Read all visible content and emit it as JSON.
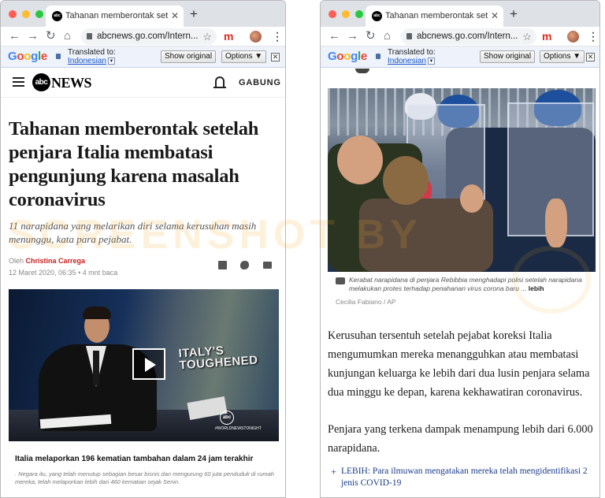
{
  "windows": [
    {
      "tab_title": "Tahanan memberontak setelah p",
      "tab_favicon": "abc",
      "address": "abcnews.go.com/Intern...",
      "translate": {
        "translated_to": "Translated to:",
        "language": "Indonesian",
        "show_original": "Show original",
        "options": "Options ▼"
      }
    },
    {
      "tab_title": "Tahanan memberontak setelah p",
      "tab_favicon": "abc",
      "address": "abcnews.go.com/Intern...",
      "translate": {
        "translated_to": "Translated to:",
        "language": "Indonesian",
        "show_original": "Show original",
        "options": "Options ▼"
      }
    }
  ],
  "icons": {
    "back": "←",
    "forward": "→",
    "reload": "↻",
    "home": "⌂",
    "star": "☆",
    "close": "✕",
    "new_tab": "+",
    "menu": "⋮",
    "extension": "m",
    "translate_close": "✕",
    "play": "play-icon"
  },
  "site": {
    "logo": "abc",
    "logo_text": "NEWS",
    "join": "GABUNG"
  },
  "article": {
    "headline": "Tahanan memberontak setelah penjara Italia membatasi pengunjung karena masalah coronavirus",
    "subhead": "11 narapidana yang melarikan diri selama kerusuhan masih menunggu, kata para pejabat.",
    "by_prefix": "Oleh",
    "author": "Christina Carrega",
    "date": "12 Maret 2020, 06:35",
    "read_time": "• 4 mnt baca",
    "video": {
      "overlay_text": "ITALY'S TOUGHENED",
      "badge": "abc",
      "hashtag": "#WORLDNEWSTONIGHT",
      "title": "Italia melaporkan 196 kematian tambahan dalam 24 jam terakhir",
      "description": ". Negara itu, yang telah menutup sebagian besar bisnis dan mengurung 60 juta penduduk di rumah mereka, telah melaporkan lebih dari 460 kematian sejak Senin."
    },
    "photo": {
      "caption": "Kerabat narapidana di penjara Rebibbia menghadapi polisi setelah narapidana melakukan protes terhadap penahanan virus corona baru ...",
      "caption_more": "lebih",
      "credit": "Cecilia Fabiano / AP"
    },
    "paragraph1": "Kerusuhan tersentuh setelah pejabat koreksi Italia mengumumkan mereka menangguhkan atau membatasi kunjungan keluarga ke lebih dari dua lusin penjara selama dua minggu ke depan, karena kekhawatiran coronavirus.",
    "paragraph2": "Penjara yang terkena dampak menampung lebih dari 6.000 narapidana.",
    "more_link": "LEBIH: Para ilmuwan mengatakan mereka telah mengidentifikasi 2 jenis COVID-19",
    "more_plus": "+"
  },
  "watermark": "SCREENSHOT BY",
  "colors": {
    "author": "#c51e1e",
    "link": "#1a3b8a",
    "tabbar": "#dee1e6",
    "translate_bar": "#edf2fb"
  }
}
